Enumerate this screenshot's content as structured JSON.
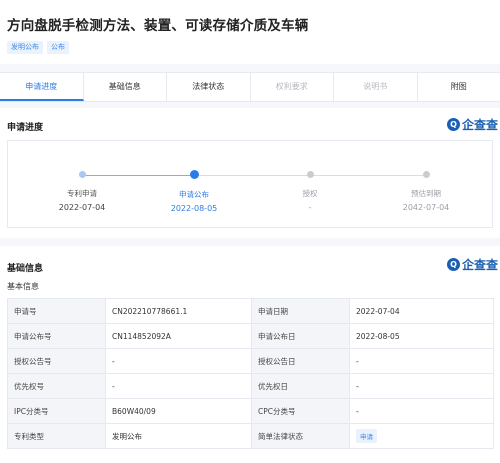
{
  "header": {
    "title": "方向盘脱手检测方法、装置、可读存储介质及车辆",
    "tags": [
      "发明公布",
      "公布"
    ]
  },
  "tabs": [
    {
      "label": "申请进度",
      "state": "active"
    },
    {
      "label": "基础信息",
      "state": "normal"
    },
    {
      "label": "法律状态",
      "state": "normal"
    },
    {
      "label": "权利要求",
      "state": "disabled"
    },
    {
      "label": "说明书",
      "state": "disabled"
    },
    {
      "label": "附图",
      "state": "normal"
    }
  ],
  "progress": {
    "section_title": "申请进度",
    "logo_text": "企查查",
    "steps": [
      {
        "label": "专利申请",
        "date": "2022-07-04",
        "state": "done"
      },
      {
        "label": "申请公布",
        "date": "2022-08-05",
        "state": "current"
      },
      {
        "label": "授权",
        "date": "-",
        "state": "future"
      },
      {
        "label": "预估到期",
        "date": "2042-07-04",
        "state": "future"
      }
    ]
  },
  "basic": {
    "section_title": "基础信息",
    "logo_text": "企查查",
    "subtitle": "基本信息",
    "rows": [
      [
        "申请号",
        "CN202210778661.1",
        "申请日期",
        "2022-07-04"
      ],
      [
        "申请公布号",
        "CN114852092A",
        "申请公布日",
        "2022-08-05"
      ],
      [
        "授权公告号",
        "-",
        "授权公告日",
        "-"
      ],
      [
        "优先权号",
        "-",
        "优先权日",
        "-"
      ],
      [
        "IPC分类号",
        "B60W40/09",
        "CPC分类号",
        "-"
      ],
      [
        "专利类型",
        "发明公布",
        "简单法律状态",
        "申请"
      ]
    ]
  },
  "colors": {
    "accent": "#2b7ce9",
    "brand": "#1a5fb4"
  }
}
